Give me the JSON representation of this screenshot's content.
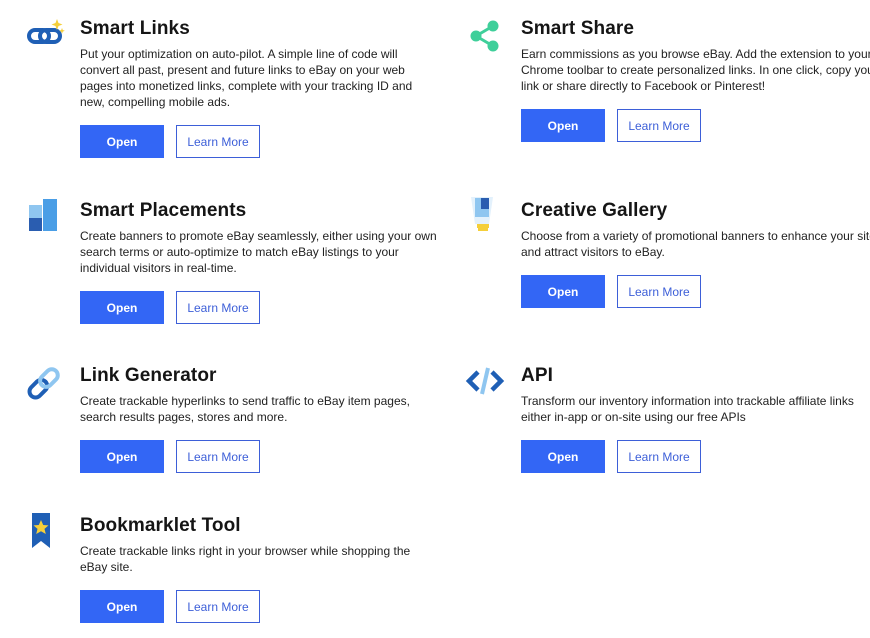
{
  "buttons": {
    "open": "Open",
    "learn_more": "Learn More"
  },
  "tools": [
    {
      "title": "Smart Links",
      "icon": "smart-links-icon",
      "description": "Put your optimization on auto-pilot. A simple line of code will convert all past, present and future links to eBay on your web pages into monetized links, complete with your tracking ID and new, compelling mobile ads."
    },
    {
      "title": "Smart Share",
      "icon": "share-icon",
      "description": "Earn commissions as you browse eBay. Add the extension to your Chrome toolbar to create personalized links. In one click, copy your link or share directly to Facebook or Pinterest!"
    },
    {
      "title": "Smart Placements",
      "icon": "placements-icon",
      "description": "Create banners to promote eBay seamlessly, either using your own search terms or auto-optimize to match eBay listings to your individual visitors in real-time."
    },
    {
      "title": "Creative Gallery",
      "icon": "gallery-icon",
      "description": "Choose from a variety of promotional banners to enhance your site and attract visitors to eBay."
    },
    {
      "title": "Link Generator",
      "icon": "link-icon",
      "description": "Create trackable hyperlinks to send traffic to eBay item pages, search results pages, stores and more."
    },
    {
      "title": "API",
      "icon": "code-icon",
      "description": "Transform our inventory information into trackable affiliate links either in-app or on-site using our free APIs"
    },
    {
      "title": "Bookmarklet Tool",
      "icon": "bookmark-icon",
      "description": "Create trackable links right in your browser while shopping the eBay site."
    }
  ],
  "colors": {
    "primary": "#3366f5",
    "share_icon": "#3fcf9a",
    "icon_blue": "#1f5fb5",
    "star": "#f5cf3a"
  }
}
